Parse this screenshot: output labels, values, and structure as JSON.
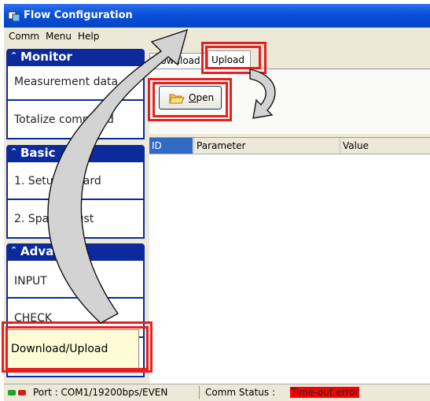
{
  "window": {
    "title": "Flow Configuration"
  },
  "menubar": {
    "items": [
      "Comm",
      "Menu",
      "Help"
    ]
  },
  "sidebar": {
    "monitor": {
      "header": "Monitor",
      "buttons": [
        "Measurement data",
        "Totalize command"
      ]
    },
    "basic": {
      "header": "Basic",
      "buttons": [
        "1. Setup Wizard",
        "2. Span Adjust"
      ]
    },
    "advanced": {
      "header": "Advanced",
      "buttons": [
        "INPUT",
        "CHECK",
        "Download/Upload"
      ]
    }
  },
  "tabs": {
    "download": "Download",
    "upload": "Upload"
  },
  "toolbar": {
    "open_label": "Open"
  },
  "table": {
    "columns": [
      "ID",
      "Parameter",
      "Value"
    ]
  },
  "status": {
    "port": "Port : COM1/19200bps/EVEN",
    "comm_label": "Comm Status :",
    "comm_value": "Time-out error"
  },
  "colors": {
    "titlebar": "#0a4fd8",
    "section_header": "#0c2a9c",
    "highlight": "#e81f1f",
    "error": "#ff0000",
    "led_green": "#1fa12b",
    "led_red": "#d51c1c"
  },
  "icons": [
    "app-icon",
    "folder-open-icon",
    "chevron-up-icon",
    "curved-arrow-icon"
  ]
}
